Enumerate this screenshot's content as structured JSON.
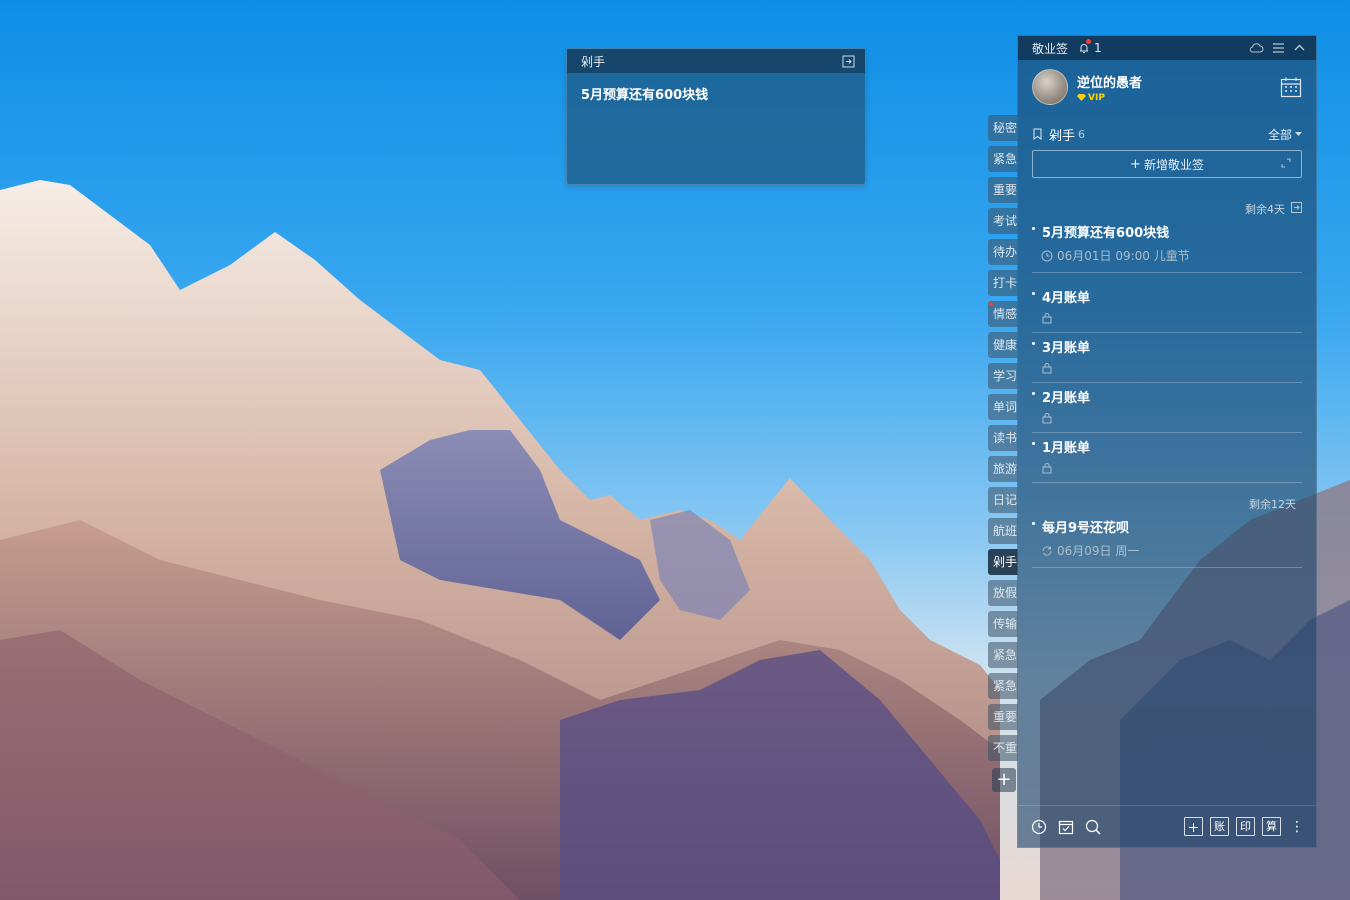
{
  "note": {
    "title": "剁手",
    "content": "5月预算还有600块钱"
  },
  "categories": [
    "秘密",
    "紧急",
    "重要",
    "考试",
    "待办",
    "打卡",
    "情感",
    "健康",
    "学习",
    "单词",
    "读书",
    "旅游",
    "日记",
    "航班",
    "剁手",
    "放假",
    "传输",
    "紧急",
    "紧急",
    "重要",
    "不重"
  ],
  "active_category": "剁手",
  "panel": {
    "app_title": "敬业签",
    "bell_count": "1",
    "user": {
      "name": "逆位的愚者",
      "vip": "VIP"
    },
    "list_name": "剁手",
    "list_count": "6",
    "filter": "全部",
    "add_label": "新增敬业签",
    "groups": [
      {
        "remain": "剩余4天",
        "items": [
          {
            "title": "5月预算还有600块钱",
            "meta": "06月01日 09:00 儿童节",
            "icon": "clock-icon"
          }
        ]
      },
      {
        "remain": "",
        "items": [
          {
            "title": "4月账单",
            "meta": "",
            "icon": "lock-icon"
          },
          {
            "title": "3月账单",
            "meta": "",
            "icon": "lock-icon"
          },
          {
            "title": "2月账单",
            "meta": "",
            "icon": "lock-icon"
          },
          {
            "title": "1月账单",
            "meta": "",
            "icon": "lock-icon"
          }
        ]
      },
      {
        "remain": "剩余12天",
        "items": [
          {
            "title": "每月9号还花呗",
            "meta": "06月09日 周一",
            "icon": "repeat-icon"
          }
        ]
      }
    ],
    "bottom_buttons": [
      "账",
      "印",
      "算"
    ]
  }
}
